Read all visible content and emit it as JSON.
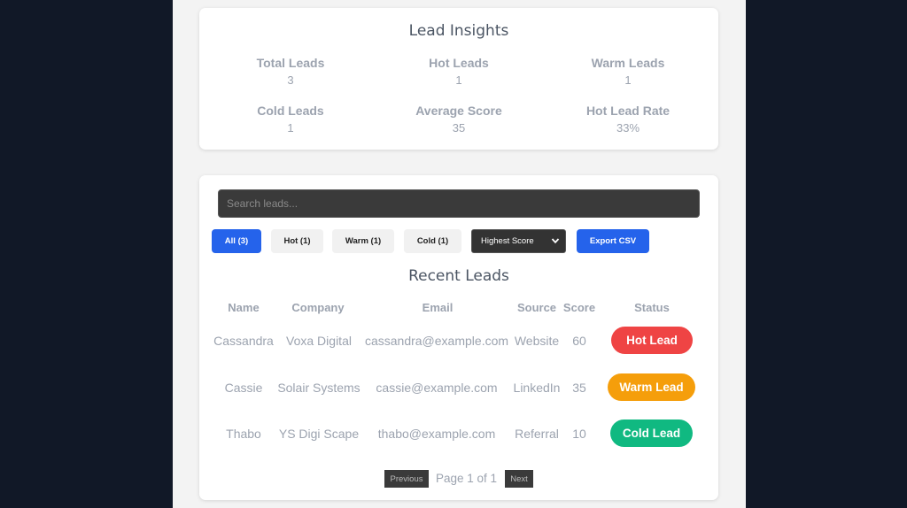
{
  "insights": {
    "title": "Lead Insights",
    "stats": [
      {
        "label": "Total Leads",
        "value": "3"
      },
      {
        "label": "Hot Leads",
        "value": "1"
      },
      {
        "label": "Warm Leads",
        "value": "1"
      },
      {
        "label": "Cold Leads",
        "value": "1"
      },
      {
        "label": "Average Score",
        "value": "35"
      },
      {
        "label": "Hot Lead Rate",
        "value": "33%"
      }
    ]
  },
  "search": {
    "placeholder": "Search leads..."
  },
  "filters": {
    "all": "All (3)",
    "hot": "Hot (1)",
    "warm": "Warm (1)",
    "cold": "Cold (1)"
  },
  "sort": {
    "selected": "Highest Score"
  },
  "export_label": "Export CSV",
  "recent": {
    "title": "Recent Leads",
    "columns": [
      "Name",
      "Company",
      "Email",
      "Source",
      "Score",
      "Status"
    ],
    "rows": [
      {
        "name": "Cassandra",
        "company": "Voxa Digital",
        "email": "cassandra@example.com",
        "source": "Website",
        "score": "60",
        "status": "Hot Lead",
        "status_color": "#ef4444"
      },
      {
        "name": "Cassie",
        "company": "Solair Systems",
        "email": "cassie@example.com",
        "source": "LinkedIn",
        "score": "35",
        "status": "Warm Lead",
        "status_color": "#f59e0b"
      },
      {
        "name": "Thabo",
        "company": "YS Digi Scape",
        "email": "thabo@example.com",
        "source": "Referral",
        "score": "10",
        "status": "Cold Lead",
        "status_color": "#10b981"
      }
    ]
  },
  "pagination": {
    "previous": "Previous",
    "page_text": "Page 1 of 1",
    "next": "Next"
  },
  "colors": {
    "accent": "#2563eb",
    "background": "#111827"
  }
}
